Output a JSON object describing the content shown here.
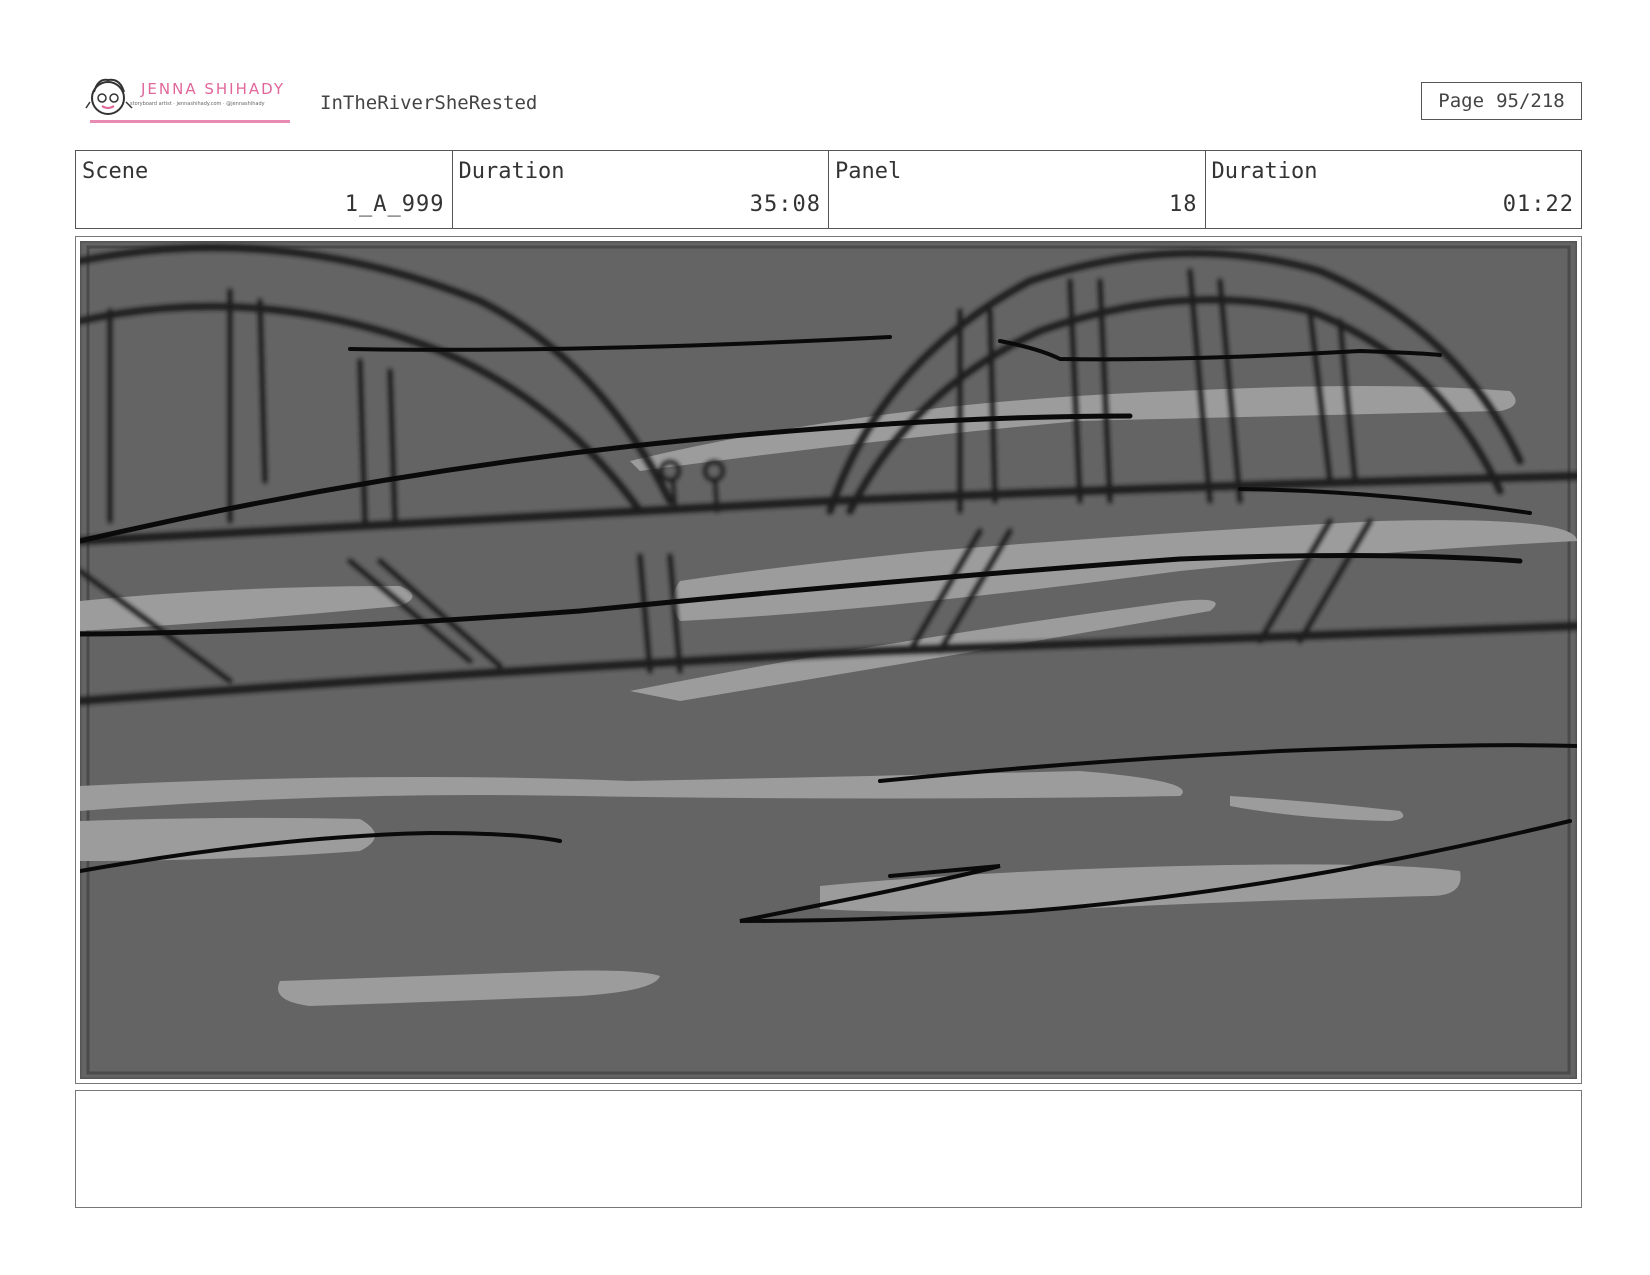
{
  "header": {
    "logo": {
      "name": "JENNA SHIHADY",
      "tagline": "storyboard artist · jennashihady.com · @jennashihady"
    },
    "project_title": "InTheRiverSheRested",
    "page": {
      "label": "Page",
      "value": "95/218"
    }
  },
  "info": {
    "scene_label": "Scene",
    "scene_value": "1_A_999",
    "scene_duration_label": "Duration",
    "scene_duration_value": "35:08",
    "panel_label": "Panel",
    "panel_value": "18",
    "panel_duration_label": "Duration",
    "panel_duration_value": "01:22"
  },
  "panel_image": {
    "icon": "bridge-sketch",
    "colors": {
      "background": "#666666",
      "highlight": "#9c9c9c",
      "line": "#111111"
    }
  },
  "notes": {
    "text": ""
  }
}
